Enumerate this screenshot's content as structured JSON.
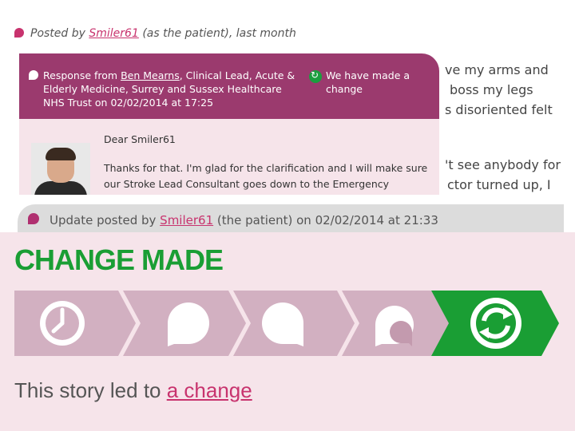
{
  "post": {
    "prefix": "Posted by ",
    "author": "Smiler61",
    "suffix": " (as the patient), last month"
  },
  "background_story": {
    "lines": [
      "ve my arms and",
      "boss my legs",
      "s disoriented felt",
      "'t see anybody for",
      "ctor turned up, I"
    ]
  },
  "response": {
    "prefix": "Response from ",
    "name": "Ben Mearns",
    "suffix": ", Clinical Lead, Acute & Elderly Medicine, Surrey and Sussex Healthcare NHS Trust on 02/02/2014 at 17:25",
    "change_label": "We have made a change",
    "greeting": "Dear Smiler61",
    "body": "Thanks for that. I'm glad for the clarification and I will make sure our Stroke Lead Consultant goes down to the Emergency"
  },
  "update": {
    "prefix": "Update posted by ",
    "author": "Smiler61",
    "suffix": " (the patient) on 02/02/2014 at 21:33"
  },
  "change": {
    "title": "CHANGE MADE",
    "stages": [
      "clock-icon",
      "speech-bubble-icon",
      "speech-bubble-icon",
      "speech-bubbles-icon",
      "change-icon"
    ],
    "led_prefix": "This story led to ",
    "led_link": "a change"
  },
  "colors": {
    "brand": "#9b3a6e",
    "link": "#c8336e",
    "green": "#1a9e34",
    "panel": "#f6e4ea"
  }
}
